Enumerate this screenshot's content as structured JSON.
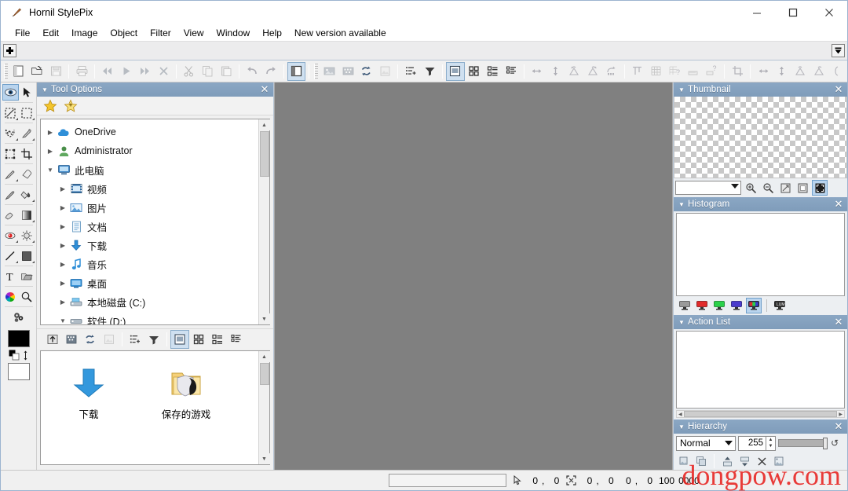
{
  "window": {
    "title": "Hornil StylePix",
    "icon": "brush-icon",
    "controls": {
      "minimize": "–",
      "maximize": "☐",
      "close": "✕"
    }
  },
  "menubar": {
    "items": [
      {
        "label": "File",
        "name": "menu-file"
      },
      {
        "label": "Edit",
        "name": "menu-edit"
      },
      {
        "label": "Image",
        "name": "menu-image"
      },
      {
        "label": "Object",
        "name": "menu-object"
      },
      {
        "label": "Filter",
        "name": "menu-filter"
      },
      {
        "label": "View",
        "name": "menu-view"
      },
      {
        "label": "Window",
        "name": "menu-window"
      },
      {
        "label": "Help",
        "name": "menu-help"
      },
      {
        "label": "New version available",
        "name": "menu-new-version"
      }
    ]
  },
  "docbar": {
    "add_label": "+",
    "overflow_label": "▼"
  },
  "toolbar": {
    "groups": [
      {
        "buttons": [
          {
            "name": "new-document-icon",
            "glyph": "new",
            "state": "enabled"
          },
          {
            "name": "open-file-icon",
            "glyph": "open",
            "state": "enabled"
          },
          {
            "name": "save-file-icon",
            "glyph": "save",
            "state": "disabled"
          }
        ]
      },
      {
        "buttons": [
          {
            "name": "print-icon",
            "glyph": "print",
            "state": "disabled"
          }
        ]
      },
      {
        "buttons": [
          {
            "name": "first-frame-icon",
            "glyph": "rewind",
            "state": "disabled"
          },
          {
            "name": "play-icon",
            "glyph": "play",
            "state": "disabled"
          },
          {
            "name": "last-frame-icon",
            "glyph": "forward",
            "state": "disabled"
          },
          {
            "name": "stop-close-icon",
            "glyph": "x",
            "state": "disabled"
          }
        ]
      },
      {
        "buttons": [
          {
            "name": "cut-icon",
            "glyph": "scissors",
            "state": "disabled"
          },
          {
            "name": "copy-icon",
            "glyph": "copy",
            "state": "disabled"
          },
          {
            "name": "paste-icon",
            "glyph": "paste",
            "state": "disabled"
          }
        ]
      },
      {
        "buttons": [
          {
            "name": "undo-icon",
            "glyph": "undo",
            "state": "disabled"
          },
          {
            "name": "redo-icon",
            "glyph": "redo",
            "state": "disabled"
          }
        ]
      },
      {
        "buttons": [
          {
            "name": "toggle-panel-icon",
            "glyph": "panel",
            "state": "active"
          }
        ]
      },
      {
        "buttons": [
          {
            "name": "image-import-icon",
            "glyph": "img1",
            "state": "disabled"
          },
          {
            "name": "image-effects-icon",
            "glyph": "img2",
            "state": "disabled"
          },
          {
            "name": "refresh-icon",
            "glyph": "refresh",
            "state": "enabled"
          },
          {
            "name": "image-properties-icon",
            "glyph": "img3",
            "state": "disabled"
          }
        ]
      },
      {
        "buttons": [
          {
            "name": "add-layer-icon",
            "glyph": "addlist",
            "state": "enabled"
          },
          {
            "name": "filter-dropdown-icon",
            "glyph": "funnel",
            "state": "enabled"
          }
        ]
      },
      {
        "buttons": [
          {
            "name": "view-thumbnail-icon",
            "glyph": "viewthumb",
            "state": "active"
          },
          {
            "name": "view-grid-icon",
            "glyph": "viewgrid",
            "state": "enabled"
          },
          {
            "name": "view-tiles-icon",
            "glyph": "viewtiles",
            "state": "enabled"
          },
          {
            "name": "view-details-icon",
            "glyph": "viewdetails",
            "state": "enabled"
          }
        ]
      },
      {
        "buttons": [
          {
            "name": "flip-horizontal-icon",
            "glyph": "fliph",
            "state": "disabled"
          },
          {
            "name": "flip-vertical-icon",
            "glyph": "flipv",
            "state": "disabled"
          },
          {
            "name": "rotate-left-icon",
            "glyph": "rotl",
            "state": "disabled"
          },
          {
            "name": "rotate-right-icon",
            "glyph": "rotr",
            "state": "disabled"
          },
          {
            "name": "rotate-free-icon",
            "glyph": "rotfree",
            "state": "disabled"
          }
        ]
      },
      {
        "buttons": [
          {
            "name": "align-top-icon",
            "glyph": "aligntop",
            "state": "disabled"
          },
          {
            "name": "grid-icon",
            "glyph": "grid",
            "state": "disabled"
          },
          {
            "name": "grid-help-icon",
            "glyph": "gridq",
            "state": "disabled"
          },
          {
            "name": "ruler-icon",
            "glyph": "ruler",
            "state": "disabled"
          },
          {
            "name": "guide-help-icon",
            "glyph": "guideq",
            "state": "disabled"
          }
        ]
      },
      {
        "buttons": [
          {
            "name": "crop-icon",
            "glyph": "crop",
            "state": "disabled"
          }
        ]
      },
      {
        "buttons": [
          {
            "name": "resize-width-icon",
            "glyph": "fliph",
            "state": "disabled"
          },
          {
            "name": "resize-height-icon",
            "glyph": "flipv",
            "state": "disabled"
          },
          {
            "name": "transform-left-icon",
            "glyph": "rotl",
            "state": "disabled"
          },
          {
            "name": "transform-right-icon",
            "glyph": "rotr",
            "state": "disabled"
          }
        ]
      }
    ]
  },
  "toolpalette": {
    "rows": [
      [
        {
          "name": "tool-eye-dropper-preview",
          "glyph": "eye",
          "selected": true,
          "sub": false
        },
        {
          "name": "tool-move",
          "glyph": "arrow",
          "selected": false,
          "sub": false
        }
      ],
      [
        {
          "name": "tool-rectangular-marquee",
          "glyph": "marquee-diag",
          "selected": false,
          "sub": true
        },
        {
          "name": "tool-selection-rect",
          "glyph": "marquee-rect",
          "selected": false,
          "sub": true
        }
      ],
      [
        {
          "name": "tool-lasso",
          "glyph": "lasso",
          "selected": false,
          "sub": true
        },
        {
          "name": "tool-eyedropper",
          "glyph": "dropper",
          "selected": false,
          "sub": true
        }
      ],
      [
        {
          "name": "tool-transform",
          "glyph": "transform",
          "selected": false,
          "sub": false
        },
        {
          "name": "tool-crop",
          "glyph": "crop",
          "selected": false,
          "sub": false
        }
      ],
      [
        {
          "name": "tool-brush",
          "glyph": "brush",
          "selected": false,
          "sub": true
        },
        {
          "name": "tool-eraser",
          "glyph": "eraser",
          "selected": false,
          "sub": false
        }
      ],
      [
        {
          "name": "tool-pencil",
          "glyph": "pencil",
          "selected": false,
          "sub": false
        },
        {
          "name": "tool-paint-bucket",
          "glyph": "bucket",
          "selected": false,
          "sub": true
        }
      ],
      [
        {
          "name": "tool-smudge",
          "glyph": "smudge",
          "selected": false,
          "sub": false
        },
        {
          "name": "tool-gradient",
          "glyph": "gradient",
          "selected": false,
          "sub": true
        }
      ],
      [
        {
          "name": "tool-red-eye",
          "glyph": "redeye",
          "selected": false,
          "sub": true
        },
        {
          "name": "tool-sharpen",
          "glyph": "sharpen",
          "selected": false,
          "sub": true
        }
      ],
      [
        {
          "name": "tool-line",
          "glyph": "line",
          "selected": false,
          "sub": true
        },
        {
          "name": "tool-shape",
          "glyph": "shape",
          "selected": false,
          "sub": true
        }
      ],
      [
        {
          "name": "tool-text",
          "glyph": "text",
          "selected": false,
          "sub": false
        },
        {
          "name": "tool-note",
          "glyph": "note",
          "selected": false,
          "sub": false
        }
      ],
      [
        {
          "name": "tool-color-picker",
          "glyph": "colorwheel",
          "selected": false,
          "sub": false
        },
        {
          "name": "tool-zoom",
          "glyph": "magnify",
          "selected": false,
          "sub": false
        }
      ],
      [
        {
          "name": "tool-settings",
          "glyph": "gears",
          "selected": false,
          "sub": false
        }
      ]
    ],
    "colors": {
      "foreground": "#000000",
      "background": "#ffffff"
    }
  },
  "tool_options_panel": {
    "title": "Tool Options",
    "close_label": "✕",
    "favorites": [
      {
        "name": "favorite-star-icon",
        "label": "star"
      },
      {
        "name": "add-favorite-star-icon",
        "label": "star-plus"
      }
    ],
    "tree": [
      {
        "label": "OneDrive",
        "indent": 0,
        "expanded": false,
        "icon": "onedrive-cloud-icon"
      },
      {
        "label": "Administrator",
        "indent": 0,
        "expanded": false,
        "icon": "user-icon"
      },
      {
        "label": "此电脑",
        "indent": 0,
        "expanded": true,
        "icon": "this-pc-icon"
      },
      {
        "label": "视频",
        "indent": 1,
        "expanded": false,
        "icon": "videos-folder-icon"
      },
      {
        "label": "图片",
        "indent": 1,
        "expanded": false,
        "icon": "pictures-folder-icon"
      },
      {
        "label": "文档",
        "indent": 1,
        "expanded": false,
        "icon": "documents-folder-icon"
      },
      {
        "label": "下载",
        "indent": 1,
        "expanded": false,
        "icon": "downloads-folder-icon"
      },
      {
        "label": "音乐",
        "indent": 1,
        "expanded": false,
        "icon": "music-folder-icon"
      },
      {
        "label": "桌面",
        "indent": 1,
        "expanded": false,
        "icon": "desktop-folder-icon"
      },
      {
        "label": "本地磁盘 (C:)",
        "indent": 1,
        "expanded": false,
        "icon": "system-drive-icon"
      },
      {
        "label": "软件 (D:)",
        "indent": 1,
        "expanded": true,
        "icon": "drive-icon"
      }
    ]
  },
  "file_browser": {
    "toolbar": [
      {
        "name": "parent-folder-icon",
        "glyph": "up",
        "state": "enabled"
      },
      {
        "name": "browse-folder-icon",
        "glyph": "img2",
        "state": "enabled"
      },
      {
        "name": "refresh-icon",
        "glyph": "refresh",
        "state": "enabled"
      },
      {
        "name": "folder-properties-icon",
        "glyph": "img3",
        "state": "disabled"
      },
      {
        "name": "add-to-list-icon",
        "glyph": "addlist",
        "state": "enabled"
      },
      {
        "name": "sort-filter-icon",
        "glyph": "funnel",
        "state": "enabled"
      },
      {
        "name": "view-thumbnail-icon",
        "glyph": "viewthumb",
        "state": "active"
      },
      {
        "name": "view-grid-icon",
        "glyph": "viewgrid",
        "state": "enabled"
      },
      {
        "name": "view-tiles-icon",
        "glyph": "viewtiles",
        "state": "enabled"
      },
      {
        "name": "view-details-icon",
        "glyph": "viewdetails",
        "state": "enabled"
      }
    ],
    "items": [
      {
        "label": "下载",
        "icon": "downloads-folder-icon"
      },
      {
        "label": "保存的游戏",
        "icon": "saved-games-folder-icon"
      }
    ]
  },
  "thumbnail_panel": {
    "title": "Thumbnail",
    "close_label": "✕",
    "zoom_value": "",
    "zoom_placeholder": "",
    "buttons": [
      {
        "name": "zoom-in-icon",
        "glyph": "zoomin"
      },
      {
        "name": "zoom-out-icon",
        "glyph": "zoomout"
      },
      {
        "name": "fit-to-window-icon",
        "glyph": "fitwin"
      },
      {
        "name": "actual-size-icon",
        "glyph": "actual"
      },
      {
        "name": "fullscreen-icon",
        "glyph": "fullscreen",
        "selected": true
      }
    ]
  },
  "histogram_panel": {
    "title": "Histogram",
    "close_label": "✕",
    "channels": [
      {
        "name": "histogram-channel-gray",
        "color": "#9a9a9a",
        "selected": false
      },
      {
        "name": "histogram-channel-red",
        "color": "#e02b2b",
        "selected": false
      },
      {
        "name": "histogram-channel-green",
        "color": "#2bd14a",
        "selected": false
      },
      {
        "name": "histogram-channel-blue",
        "color": "#4a3ccd",
        "selected": false
      },
      {
        "name": "histogram-channel-rgb",
        "color": "rgb",
        "selected": true
      },
      {
        "name": "histogram-channel-luminosity",
        "color": "#3a3a3a",
        "selected": false
      }
    ]
  },
  "action_list_panel": {
    "title": "Action List",
    "close_label": "✕"
  },
  "hierarchy_panel": {
    "title": "Hierarchy",
    "close_label": "✕",
    "blend_mode": "Normal",
    "opacity": "255",
    "reset_label": "↺",
    "buttons": [
      {
        "name": "new-layer-icon",
        "glyph": "layernew"
      },
      {
        "name": "duplicate-layer-icon",
        "glyph": "layerdup"
      },
      {
        "name": "move-layer-up-icon",
        "glyph": "layerup"
      },
      {
        "name": "move-layer-down-icon",
        "glyph": "layerdown"
      },
      {
        "name": "delete-layer-icon",
        "glyph": "x"
      },
      {
        "name": "layer-properties-icon",
        "glyph": "layerprops"
      }
    ]
  },
  "statusbar": {
    "message": "",
    "cursor_icon": "cursor-arrow-icon",
    "cursor_x": "0",
    "cursor_separator": ",",
    "cursor_y": "0",
    "selection_icon": "selection-size-icon",
    "selection_x": "0",
    "selection_separator": ",",
    "selection_y": "0",
    "doc_x": "0",
    "doc_separator": ",",
    "doc_y": "0",
    "zoom": "100",
    "extra": "0000"
  },
  "watermark": {
    "text": "dongpow.com",
    "color": "#e8231f"
  },
  "canvas": {
    "background": "#808080"
  }
}
